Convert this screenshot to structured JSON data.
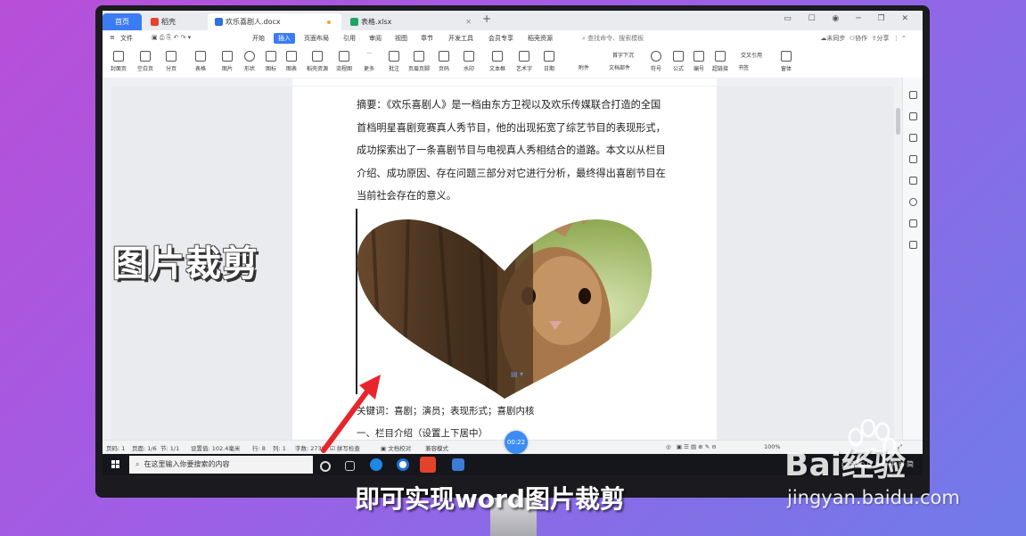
{
  "titlebar": {
    "tabs": [
      {
        "label": "首页",
        "color": "#3b7bf4"
      },
      {
        "label": "稻壳",
        "color": "#e8412c"
      },
      {
        "label": "欢乐喜剧人.docx",
        "color": "#2f6fde"
      },
      {
        "label": "表格.xlsx",
        "color": "#1fa463"
      }
    ],
    "new_tab": "+"
  },
  "menubar": {
    "file": "文件",
    "items": [
      "开始",
      "插入",
      "页面布局",
      "引用",
      "审阅",
      "视图",
      "章节",
      "开发工具",
      "会员专享",
      "稻壳资源"
    ],
    "active": "插入",
    "search": "查找命令、搜索模板",
    "right": [
      "未同步",
      "协作",
      "分享"
    ]
  },
  "ribbon": {
    "items": [
      "封面页",
      "空白页",
      "分页",
      "表格",
      "图片",
      "形状",
      "图标",
      "图表",
      "稻壳资源",
      "流程图",
      "更多",
      "批注",
      "页眉页脚",
      "页码",
      "水印",
      "文本框",
      "艺术字",
      "日期",
      "附件",
      "文档部件",
      "符号",
      "公式",
      "编号",
      "超链接",
      "书签",
      "窗体"
    ],
    "extra": [
      "首字下沉",
      "交叉引用"
    ]
  },
  "document": {
    "abstract": "摘要：《欢乐喜剧人》是一档由东方卫视以及欢乐传媒联合打造的全国首档明星喜剧竞赛真人秀节目，他的出现拓宽了综艺节目的表现形式，成功探索出了一条喜剧节目与电视真人秀相结合的道路。本文以从栏目介绍、成功原因、存在问题三部分对它进行分析，最终得出喜剧节目在当前社会存在的意义。",
    "keywords": "关键词：喜剧；演员；表现形式；喜剧内核",
    "section1": "一、栏目介绍（设置上下居中）"
  },
  "statusbar": {
    "page": "页码: 1",
    "pages": "页面: 1/6",
    "section": "节: 1/1",
    "setting": "设置值: 102.4毫米",
    "row": "行: 8",
    "col": "列: 1",
    "words": "字数: 2738",
    "spell": "拼写检查",
    "proof": "文档校对",
    "compat": "兼容模式",
    "zoom": "100%",
    "timer": "00:22"
  },
  "taskbar": {
    "search_placeholder": "在这里输入你要搜索的内容",
    "ime": "中",
    "ime2": "简"
  },
  "overlays": {
    "title": "图片裁剪",
    "subtitle": "即可实现word图片裁剪",
    "watermark_logo": "Bai经验",
    "watermark_url": "jingyan.baidu.com"
  },
  "colors": {
    "accent": "#3b7bf4",
    "background_start": "#b84fd8",
    "background_end": "#6f7be8"
  }
}
